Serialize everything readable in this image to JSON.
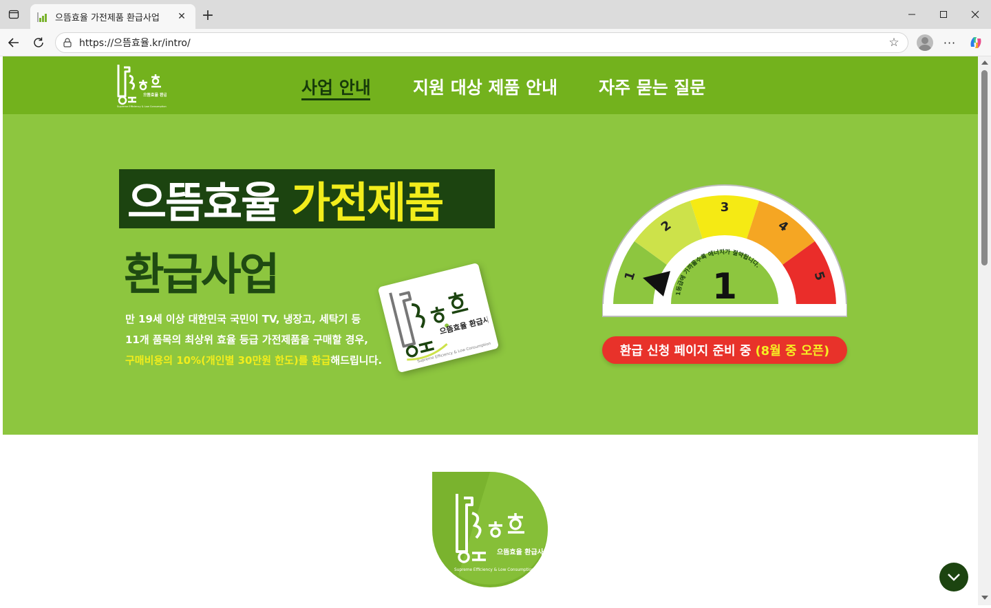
{
  "browser": {
    "tab_title": "으뜸효율 가전제품 환급사업",
    "tab_close": "✕",
    "new_tab": "+",
    "url": "https://으뜸효율.kr/intro/",
    "more": "···"
  },
  "header": {
    "nav": [
      {
        "label": "사업 안내",
        "active": true
      },
      {
        "label": "지원 대상 제품 안내",
        "active": false
      },
      {
        "label": "자주 묻는 질문",
        "active": false
      }
    ]
  },
  "hero": {
    "title_white": "으뜸효율",
    "title_yellow": "가전제품",
    "title_line2": "환급사업",
    "desc_line1": "만 19세 이상 대한민국 국민이 TV, 냉장고, 세탁기 등",
    "desc_line2": "11개 품목의 최상위 효율 등급 가전제품을 구매할 경우,",
    "desc_line3_highlight": "구매비용의 10%(개인별 30만원 한도)를 환급",
    "desc_line3_rest": "해드립니다.",
    "cta_white": "환급 신청 페이지 준비 중",
    "cta_yellow": "(8월 중 오픈)"
  },
  "gauge": {
    "grades": [
      "1",
      "2",
      "3",
      "4",
      "5"
    ],
    "center_number": "1",
    "arc_text": "1등급에 가까울수록 에너지가 절약됩니다.",
    "colors": [
      "#8dc63f",
      "#cde24a",
      "#f5ea14",
      "#f5a623",
      "#ea2d2a"
    ]
  },
  "logo": {
    "text_small": "으뜸효율 환급사업",
    "tagline": "Supreme Efficiency & Low Consumption"
  },
  "colors": {
    "header_green": "#73b21d",
    "hero_green": "#8dc63f",
    "dark_green": "#1c4410",
    "yellow": "#f2ed1c",
    "red": "#e8322a"
  }
}
